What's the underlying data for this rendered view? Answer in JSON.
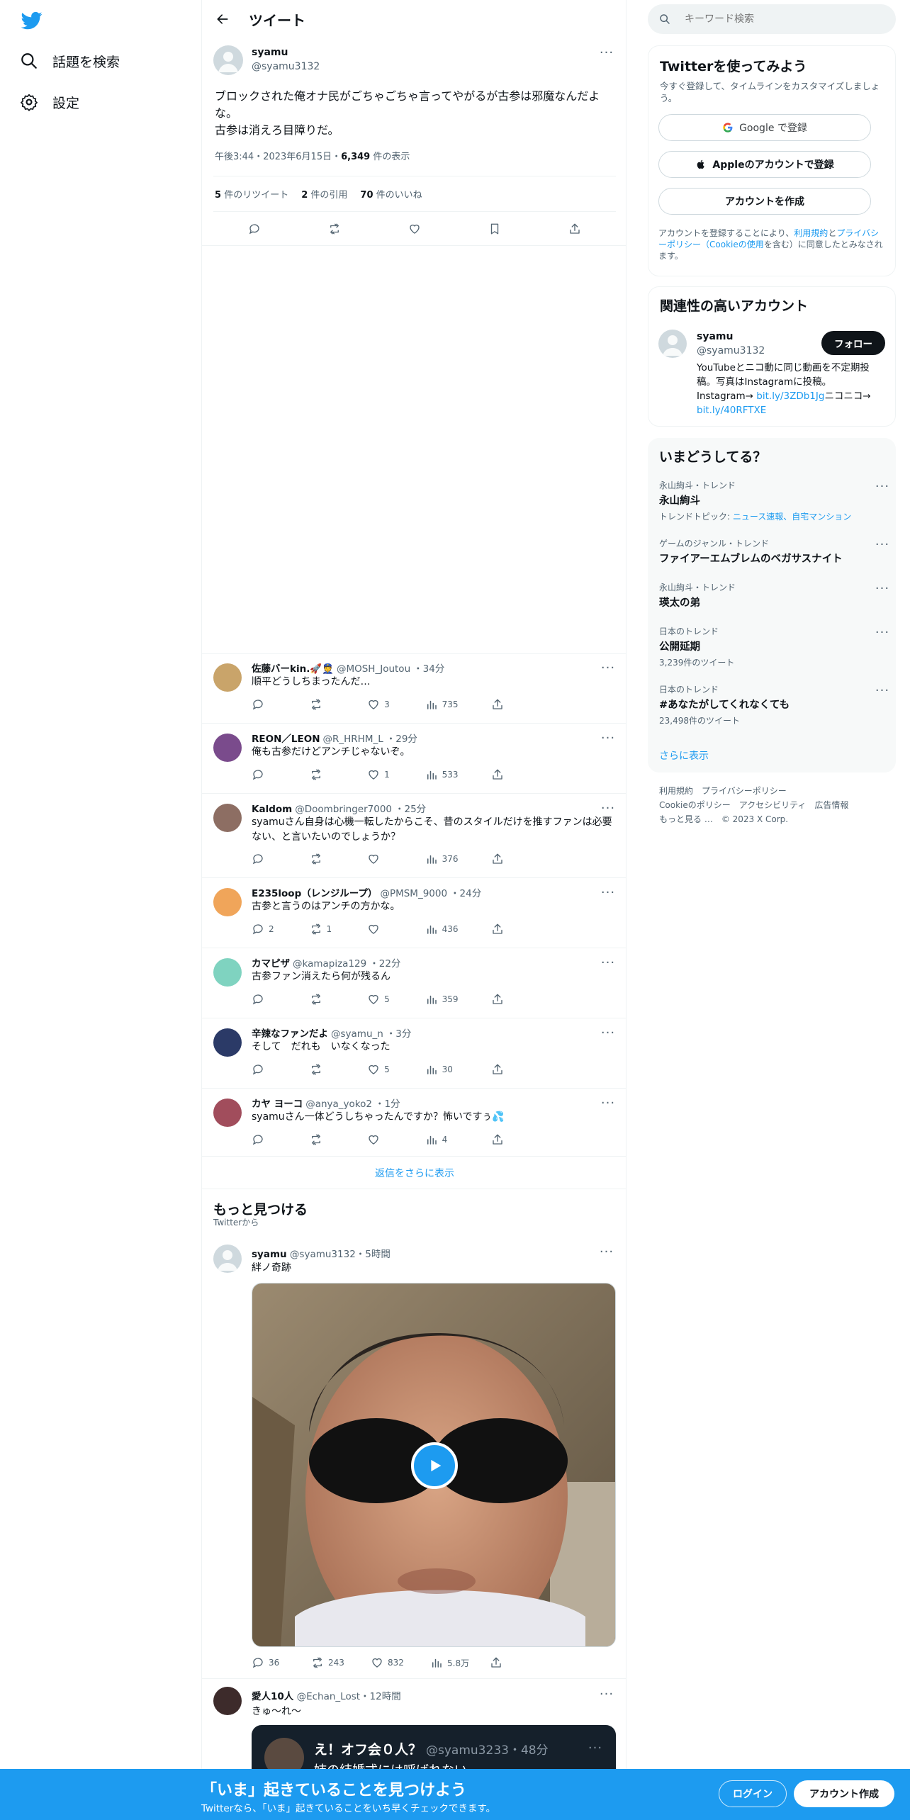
{
  "nav": {
    "explore_label": "話題を検索",
    "settings_label": "設定"
  },
  "header": {
    "title": "ツイート"
  },
  "main_tweet": {
    "name": "syamu",
    "handle": "@syamu3132",
    "text": "ブロックされた俺オナ民がごちゃごちゃ言ってやがるが古参は邪魔なんだよな。\n古参は消えろ目障りだ。",
    "time": "午後3:44・2023年6月15日・",
    "views_count": "6,349",
    "views_label": " 件の表示",
    "retweets_count": "5",
    "retweets_label": "件のリツイート",
    "quotes_count": "2",
    "quotes_label": "件の引用",
    "likes_count": "70",
    "likes_label": "件のいいね"
  },
  "replies": [
    {
      "name": "佐藤バーkin.🚀👮",
      "handle": "@MOSH_Joutou",
      "time": "・34分",
      "text": "順平どうしちまったんだ…",
      "replies": "",
      "retweets": "",
      "likes": "3",
      "views": "735",
      "avatar_color": "#c9a46a"
    },
    {
      "name": "REON／LEON",
      "handle": "@R_HRHM_L",
      "time": "・29分",
      "text": "俺も古参だけどアンチじゃないぞ。",
      "replies": "",
      "retweets": "",
      "likes": "1",
      "views": "533",
      "avatar_color": "#7a4b8c"
    },
    {
      "name": "Kaldom",
      "handle": "@Doombringer7000",
      "time": "・25分",
      "text": "syamuさん自身は心機一転したからこそ、昔のスタイルだけを推すファンは必要ない、と言いたいのでしょうか？",
      "replies": "",
      "retweets": "",
      "likes": "",
      "views": "376",
      "avatar_color": "#8d6e63"
    },
    {
      "name": "E235loop（レンジループ）",
      "handle": "@PMSM_9000",
      "time": "・24分",
      "text": "古参と言うのはアンチの方かな。",
      "replies": "2",
      "retweets": "1",
      "likes": "",
      "views": "436",
      "avatar_color": "#f0a55a"
    },
    {
      "name": "カマピザ",
      "handle": "@kamapiza129",
      "time": "・22分",
      "text": "古参ファン消えたら何が残るん",
      "replies": "",
      "retweets": "",
      "likes": "5",
      "views": "359",
      "avatar_color": "#7fd3c0"
    },
    {
      "name": "辛辣なファンだよ",
      "handle": "@syamu_n",
      "time": "・3分",
      "text": "そして　だれも　いなくなった",
      "replies": "",
      "retweets": "",
      "likes": "5",
      "views": "30",
      "avatar_color": "#2b3a67"
    },
    {
      "name": "カヤ ヨーコ",
      "handle": "@anya_yoko2",
      "time": "・1分",
      "text": "syamuさん一体どうしちゃったんですか？怖いですぅ💦",
      "replies": "",
      "retweets": "",
      "likes": "",
      "views": "4",
      "avatar_color": "#a14d5c"
    }
  ],
  "show_more_replies": "返信をさらに表示",
  "discover": {
    "title": "もっと見つける",
    "subtitle": "Twitterから",
    "tweet1": {
      "name": "syamu",
      "handle": "@syamu3132",
      "time": "・5時間",
      "text": "絆ノ奇跡",
      "replies": "36",
      "retweets": "243",
      "likes": "832",
      "views": "5.8万"
    },
    "tweet2": {
      "name": "愛人10人",
      "handle": "@Echan_Lost",
      "time": "・12時間",
      "text": "きゅ〜れ〜",
      "quote_name": "え！オフ会０人？",
      "quote_handle": "@syamu3233・48分",
      "quote_text": "姉の結婚式には呼ばれない"
    }
  },
  "search": {
    "placeholder": "キーワード検索"
  },
  "signup": {
    "title": "Twitterを使ってみよう",
    "subtitle": "今すぐ登録して、タイムラインをカスタマイズしましょう。",
    "google": "Google で登録",
    "apple": "Appleのアカウントで登録",
    "create": "アカウントを作成",
    "terms_pre": "アカウントを登録することにより、",
    "terms_link1": "利用規約",
    "terms_mid": "と",
    "terms_link2": "プライバシーポリシー",
    "terms_link3": "（Cookieの使用",
    "terms_post": "を含む）に同意したとみなされます。"
  },
  "relevant": {
    "title": "関連性の高いアカウント",
    "name": "syamu",
    "handle": "@syamu3132",
    "follow": "フォロー",
    "bio": "YouTubeとニコ動に同じ動画を不定期投稿。写真はInstagramに投稿。Instagram→ ",
    "bio_link1": "bit.ly/3ZDb1Jg",
    "bio_mid": "ニコニコ→ ",
    "bio_link2": "bit.ly/40RFTXE"
  },
  "trends": {
    "title": "いまどうしてる？",
    "items": [
      {
        "category": "永山絢斗・トレンド",
        "name": "永山絢斗",
        "meta_pre": "トレンドトピック: ",
        "meta_link": "ニュース速報、自宅マンション"
      },
      {
        "category": "ゲームのジャンル・トレンド",
        "name": "ファイアーエムブレムのベガサスナイト",
        "meta_pre": "",
        "meta_link": ""
      },
      {
        "category": "永山絢斗・トレンド",
        "name": "瑛太の弟",
        "meta_pre": "",
        "meta_link": ""
      },
      {
        "category": "日本のトレンド",
        "name": "公開延期",
        "meta_pre": "3,239件のツイート",
        "meta_link": ""
      },
      {
        "category": "日本のトレンド",
        "name": "#あなたがしてくれなくても",
        "meta_pre": "23,498件のツイート",
        "meta_link": ""
      }
    ],
    "show_more": "さらに表示"
  },
  "footer": {
    "terms": "利用規約",
    "privacy": "プライバシーポリシー",
    "cookie": "Cookieのポリシー",
    "accessibility": "アクセシビリティ",
    "ads": "広告情報",
    "more": "もっと見る …",
    "copyright": "© 2023 X Corp."
  },
  "bottom_bar": {
    "headline": "「いま」起きていることを見つけよう",
    "sub": "Twitterなら、「いま」起きていることをいち早くチェックできます。",
    "login": "ログイン",
    "signup": "アカウント作成"
  },
  "colors": {
    "accent": "#1d9bf0",
    "text": "#0f1419",
    "muted": "#536471"
  }
}
